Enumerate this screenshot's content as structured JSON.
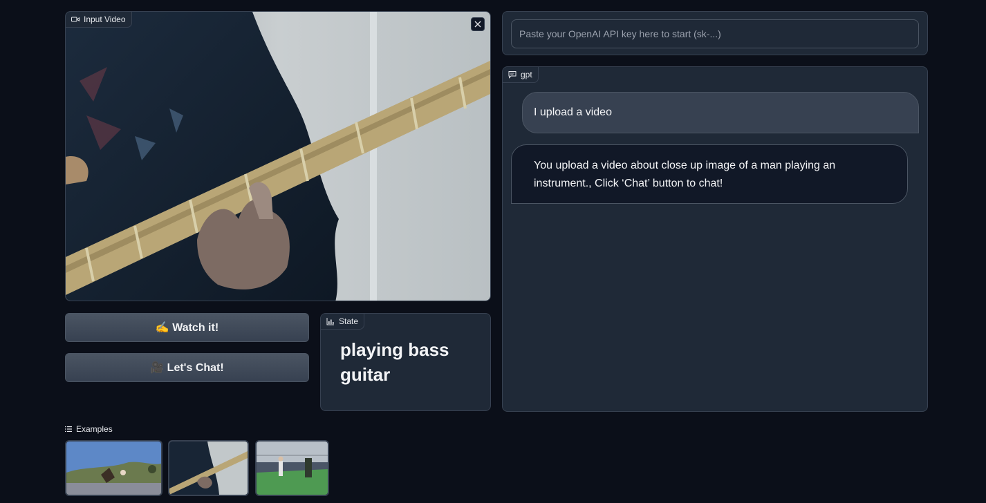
{
  "video": {
    "label": "Input Video",
    "icon": "video-icon",
    "close_icon": "close-icon"
  },
  "api": {
    "placeholder": "Paste your OpenAI API key here to start (sk-...)"
  },
  "chat": {
    "label": "gpt",
    "icon": "chat-icon",
    "messages": [
      {
        "role": "user",
        "text": "I upload a video"
      },
      {
        "role": "bot",
        "text": "You upload a video about close up image of a man playing an instrument., Click ‘Chat’ button to chat!"
      }
    ]
  },
  "buttons": {
    "watch_label": "✍️ Watch it!",
    "chat_label": "🎥 Let's Chat!"
  },
  "state": {
    "label": "State",
    "icon": "bar-chart-icon",
    "value": "playing bass guitar"
  },
  "examples": {
    "label": "Examples",
    "icon": "list-icon",
    "items": [
      {
        "icon": "video-thumbnail-outdoor-dance"
      },
      {
        "icon": "video-thumbnail-bass-guitar"
      },
      {
        "icon": "video-thumbnail-baseball-practice"
      }
    ]
  },
  "colors": {
    "background": "#0b0f19",
    "panel": "#1f2937",
    "border": "#374151",
    "button": "#4b5563"
  }
}
